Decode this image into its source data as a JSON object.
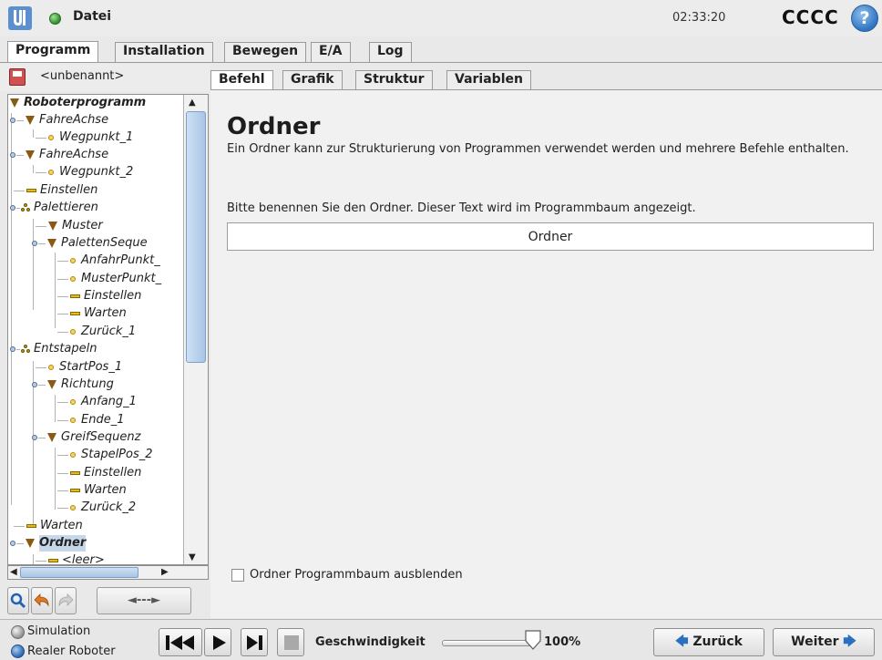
{
  "titlebar": {
    "file_menu": "Datei",
    "clock": "02:33:20",
    "robot_name": "CCCC",
    "help": "?"
  },
  "main_tabs": [
    {
      "label": "Programm",
      "active": true
    },
    {
      "label": "Installation",
      "active": false
    },
    {
      "label": "Bewegen",
      "active": false
    },
    {
      "label": "E/A",
      "active": false
    },
    {
      "label": "Log",
      "active": false
    }
  ],
  "program": {
    "name": "<unbenannt>"
  },
  "tree": {
    "nodes": [
      {
        "label": "Roboterprogramm",
        "icon": "triangle-icon"
      },
      {
        "label": "FahreAchse",
        "icon": "triangle-icon"
      },
      {
        "label": "Wegpunkt_1",
        "icon": "waypoint-icon"
      },
      {
        "label": "FahreAchse",
        "icon": "triangle-icon"
      },
      {
        "label": "Wegpunkt_2",
        "icon": "waypoint-icon"
      },
      {
        "label": "Einstellen",
        "icon": "bar-icon"
      },
      {
        "label": "Palettieren",
        "icon": "pallet-icon"
      },
      {
        "label": "Muster",
        "icon": "triangle-icon"
      },
      {
        "label": "PalettenSeque",
        "icon": "triangle-icon"
      },
      {
        "label": "AnfahrPunkt_",
        "icon": "waypoint-icon"
      },
      {
        "label": "MusterPunkt_",
        "icon": "waypoint-icon"
      },
      {
        "label": "Einstellen",
        "icon": "bar-icon"
      },
      {
        "label": "Warten",
        "icon": "bar-icon"
      },
      {
        "label": "Zurück_1",
        "icon": "waypoint-icon"
      },
      {
        "label": "Entstapeln",
        "icon": "pallet-icon"
      },
      {
        "label": "StartPos_1",
        "icon": "waypoint-icon"
      },
      {
        "label": "Richtung",
        "icon": "triangle-icon"
      },
      {
        "label": "Anfang_1",
        "icon": "waypoint-icon"
      },
      {
        "label": "Ende_1",
        "icon": "waypoint-icon"
      },
      {
        "label": "GreifSequenz",
        "icon": "triangle-icon"
      },
      {
        "label": "StapelPos_2",
        "icon": "waypoint-icon"
      },
      {
        "label": "Einstellen",
        "icon": "bar-icon"
      },
      {
        "label": "Warten",
        "icon": "bar-icon"
      },
      {
        "label": "Zurück_2",
        "icon": "waypoint-icon"
      },
      {
        "label": "Warten",
        "icon": "bar-icon"
      },
      {
        "label": "Ordner",
        "icon": "triangle-icon"
      },
      {
        "label": "<leer>",
        "icon": "bar-icon"
      }
    ]
  },
  "toolbar": {
    "move_label": "◄---►"
  },
  "sub_tabs": [
    {
      "label": "Befehl",
      "active": true
    },
    {
      "label": "Grafik",
      "active": false
    },
    {
      "label": "Struktur",
      "active": false
    },
    {
      "label": "Variablen",
      "active": false
    }
  ],
  "folder": {
    "title": "Ordner",
    "description": "Ein Ordner kann zur Strukturierung von Programmen verwendet werden und mehrere Befehle enthalten.",
    "name_prompt": "Bitte benennen Sie den Ordner. Dieser Text wird im Programmbaum angezeigt.",
    "name_value": "Ordner",
    "hide_label": "Ordner Programmbaum ausblenden",
    "hide_checked": false
  },
  "footer": {
    "mode_simulation": "Simulation",
    "mode_real": "Realer Roboter",
    "speed_label": "Geschwindigkeit",
    "speed_value": "100%",
    "speed_fraction": 1.0,
    "back_label": "Zurück",
    "next_label": "Weiter"
  }
}
